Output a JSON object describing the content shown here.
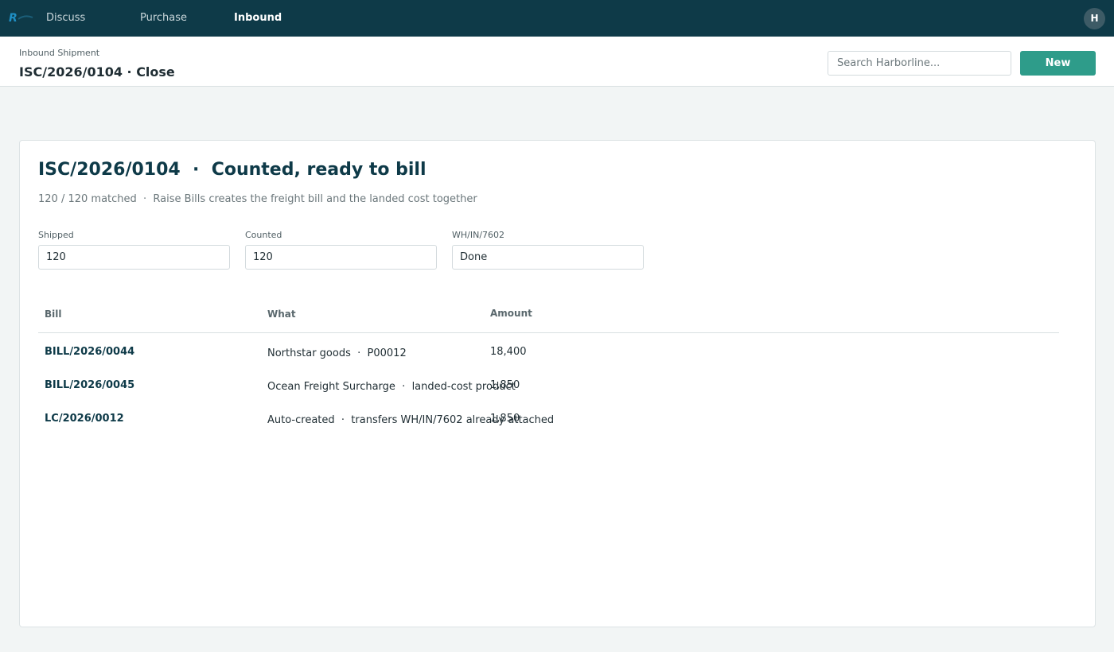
{
  "nav": {
    "items": [
      {
        "label": "Discuss"
      },
      {
        "label": "Purchase"
      },
      {
        "label": "Inbound"
      }
    ],
    "avatar": "H"
  },
  "control_panel": {
    "breadcrumb": "Inbound Shipment",
    "title": "ISC/2026/0104 · Close",
    "search_placeholder": "Search Harborline...",
    "new_label": "New"
  },
  "card": {
    "title": "ISC/2026/0104  ·  Counted, ready to bill",
    "subtitle": "120 / 120 matched  ·  Raise Bills creates the freight bill and the landed cost together",
    "fields": [
      {
        "label": "Shipped",
        "value": "120"
      },
      {
        "label": "Counted",
        "value": "120"
      },
      {
        "label": "WH/IN/7602",
        "value": "Done"
      }
    ]
  },
  "table": {
    "headers": {
      "bill": "Bill",
      "what": "What",
      "amount": "Amount"
    },
    "rows": [
      {
        "bill": "BILL/2026/0044",
        "what": "Northstar goods  ·  P00012",
        "amount": "18,400"
      },
      {
        "bill": "BILL/2026/0045",
        "what": "Ocean Freight Surcharge  ·  landed-cost product",
        "amount": "1,850"
      },
      {
        "bill": "LC/2026/0012",
        "what": "Auto-created  ·  transfers WH/IN/7602 already attached",
        "amount": "1,850"
      }
    ]
  },
  "colors": {
    "topbar": "#0e3a48",
    "accent": "#2e9c8a",
    "link": "#0e3a48"
  }
}
